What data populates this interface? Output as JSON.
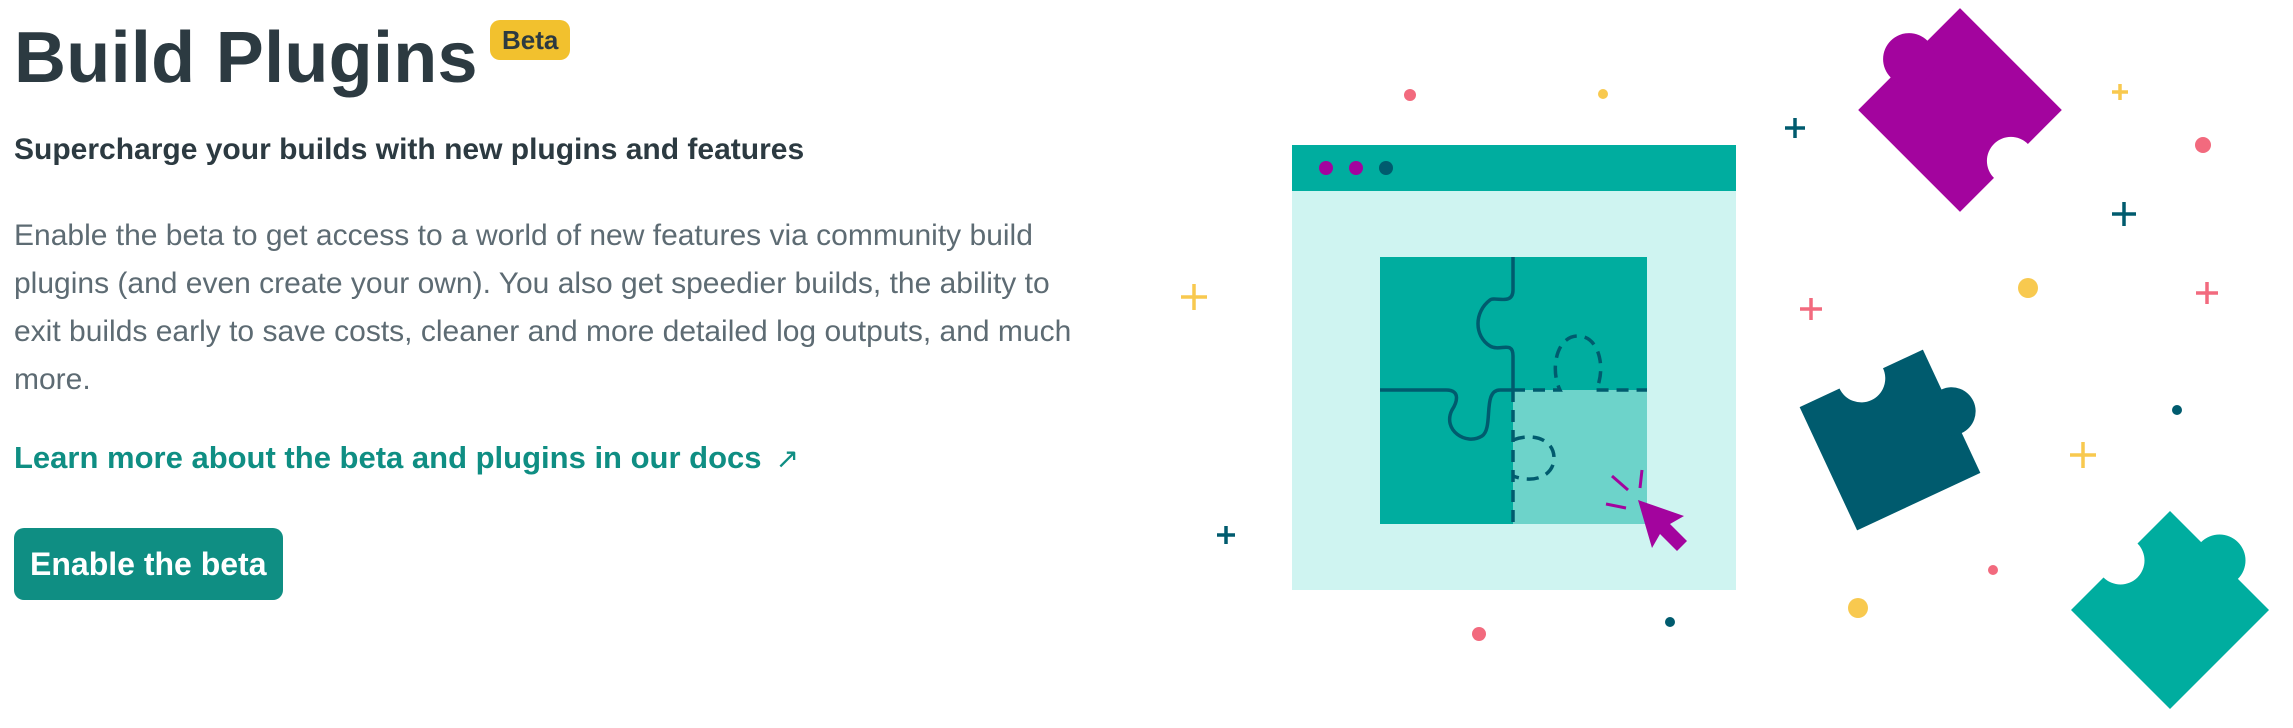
{
  "header": {
    "title": "Build Plugins",
    "badge": "Beta"
  },
  "content": {
    "subtitle": "Supercharge your builds with new plugins and features",
    "description": "Enable the beta to get access to a world of new features via community build plugins (and even create your own). You also get speedier builds, the ability to exit builds early to save costs, cleaner and more detailed log outputs, and much more.",
    "link_text": "Learn more about the beta and plugins in our docs",
    "link_arrow": "↗",
    "button_label": "Enable the beta"
  },
  "illustration": {
    "colors": {
      "teal": "#00ad9f",
      "dark_teal": "#005b6e",
      "light_teal": "#6dd3ca",
      "pale_teal": "#cff4f1",
      "magenta": "#a3049e",
      "coral": "#f26a7e",
      "yellow": "#f8c94f",
      "cursor": "#a3049e"
    }
  }
}
